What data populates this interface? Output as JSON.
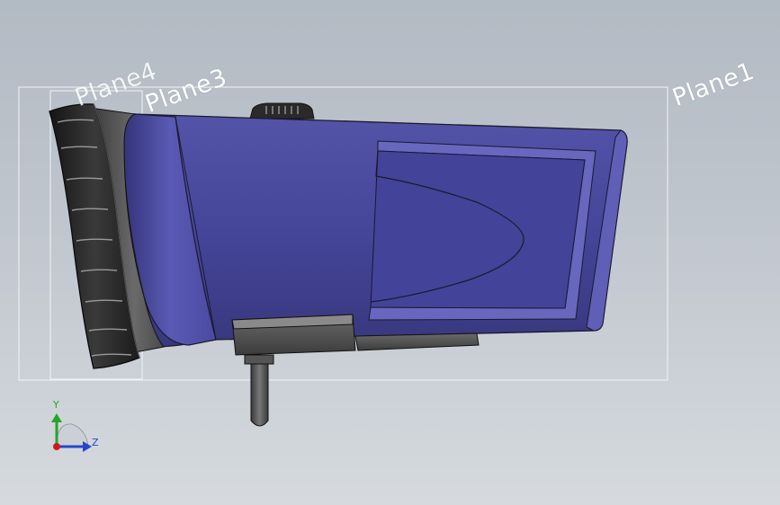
{
  "planes": {
    "plane1": "Plane1",
    "plane3": "Plane3",
    "plane4": "Plane4"
  },
  "triad": {
    "y_label": "Y",
    "z_label": "Z",
    "y_color": "#23a62a",
    "z_color": "#2447c8",
    "x_color": "#d01a1a"
  },
  "colors": {
    "background_top": "#b2bac3",
    "background_bottom": "#d6dade",
    "body_purple": "#4a4a9c",
    "bezel_dark": "#2b2b2b",
    "plane_outline": "#f2f4f6"
  }
}
